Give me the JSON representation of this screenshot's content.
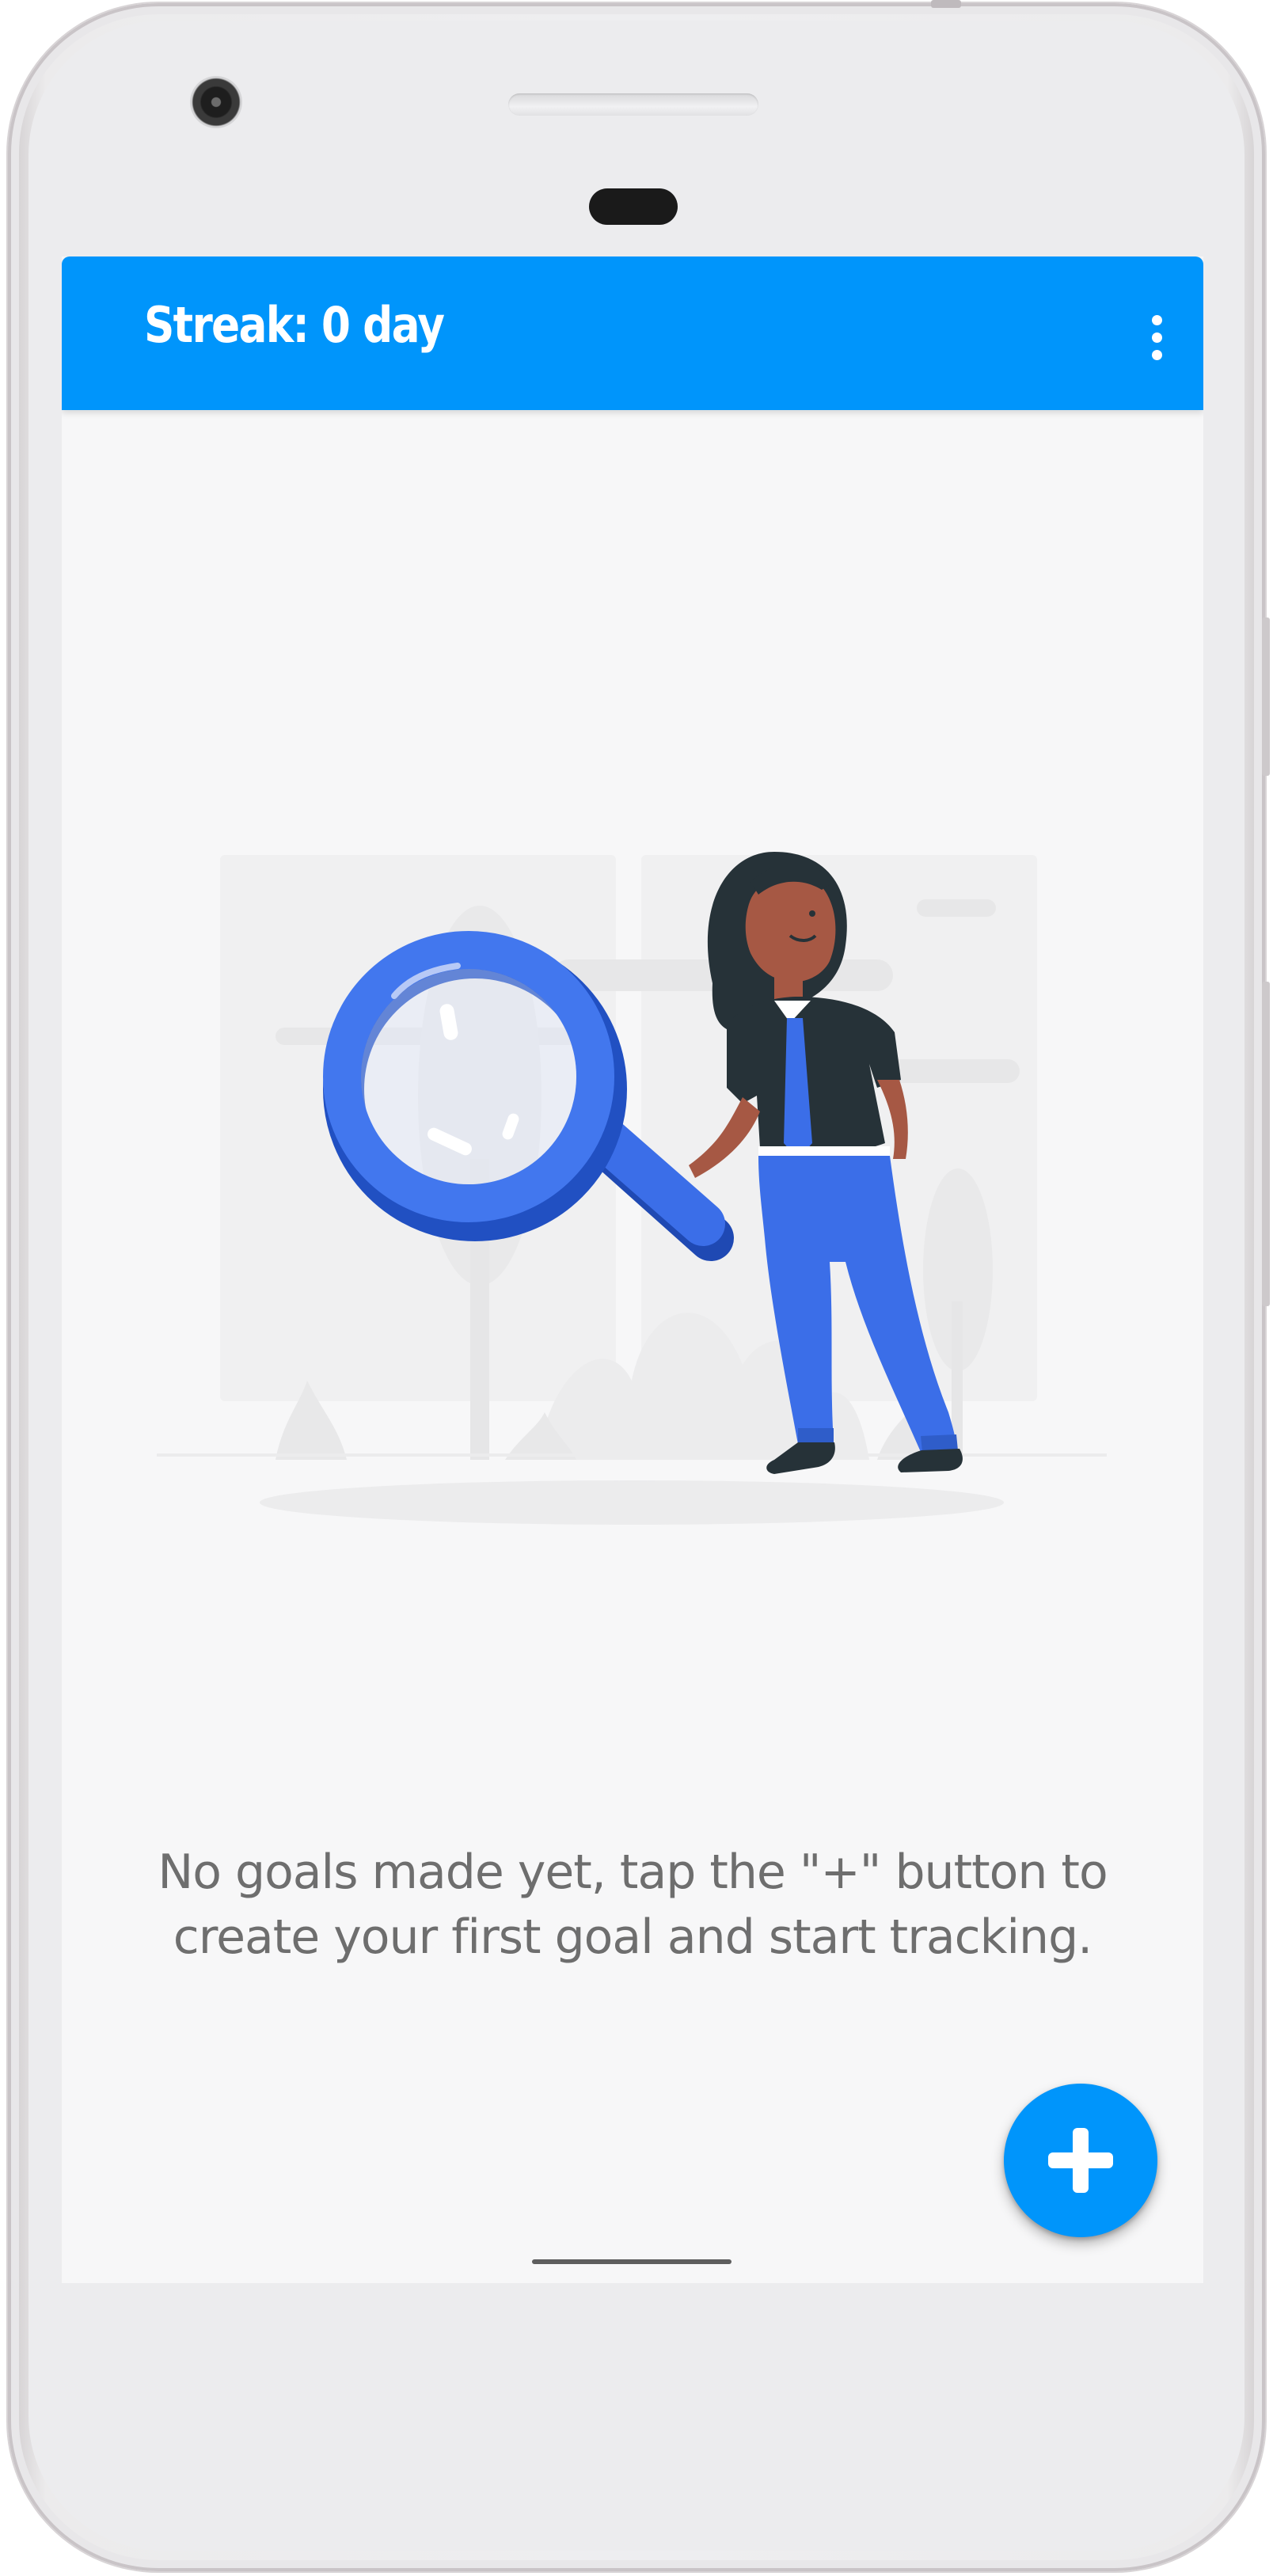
{
  "app_bar": {
    "title": "Streak: 0 day",
    "menu_icon": "more-vert-icon"
  },
  "empty_state": {
    "illustration": "searching-woman-with-magnifier-illustration",
    "message": "No goals made yet, tap the \"+\" button to create your first goal and start tracking."
  },
  "fab": {
    "icon": "plus-icon"
  },
  "colors": {
    "primary": "#0095fb",
    "background": "#f7f7f8",
    "text_secondary": "#6e6e6e",
    "illustration_blue": "#3f72e6",
    "illustration_dark": "#263238"
  }
}
